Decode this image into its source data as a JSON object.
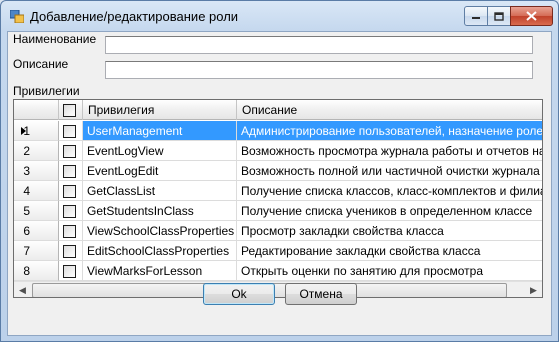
{
  "window": {
    "title": "Добавление/редактирование роли"
  },
  "form": {
    "name_label": "Наименование",
    "name_value": "",
    "desc_label": "Описание",
    "desc_value": "",
    "privileges_label": "Привилегии"
  },
  "grid": {
    "columns": {
      "privilege": "Привилегия",
      "description": "Описание"
    },
    "selected_row": 0,
    "rows": [
      {
        "num": "1",
        "privilege": "UserManagement",
        "description": "Администрирование пользователей, назначение ролей и",
        "checked": false
      },
      {
        "num": "2",
        "privilege": "EventLogView",
        "description": "Возможность просмотра журнала работы и отчетов на е",
        "checked": false
      },
      {
        "num": "3",
        "privilege": "EventLogEdit",
        "description": "Возможность полной или частичной очистки журнала ра",
        "checked": false
      },
      {
        "num": "4",
        "privilege": "GetClassList",
        "description": "Получение списка классов, класс-комплектов и филиал",
        "checked": false
      },
      {
        "num": "5",
        "privilege": "GetStudentsInClass",
        "description": "Получение списка учеников в определенном классе",
        "checked": false
      },
      {
        "num": "6",
        "privilege": "ViewSchoolClassProperties",
        "description": "Просмотр закладки свойства класса",
        "checked": false
      },
      {
        "num": "7",
        "privilege": "EditSchoolClassProperties",
        "description": "Редактирование закладки свойства класса",
        "checked": false
      },
      {
        "num": "8",
        "privilege": "ViewMarksForLesson",
        "description": "Открыть оценки по занятию для просмотра",
        "checked": false
      }
    ]
  },
  "buttons": {
    "ok": "Ok",
    "cancel": "Отмена"
  },
  "icons": {
    "app": "app-icon",
    "minimize": "minimize-icon",
    "maximize": "maximize-icon",
    "close": "close-icon"
  }
}
